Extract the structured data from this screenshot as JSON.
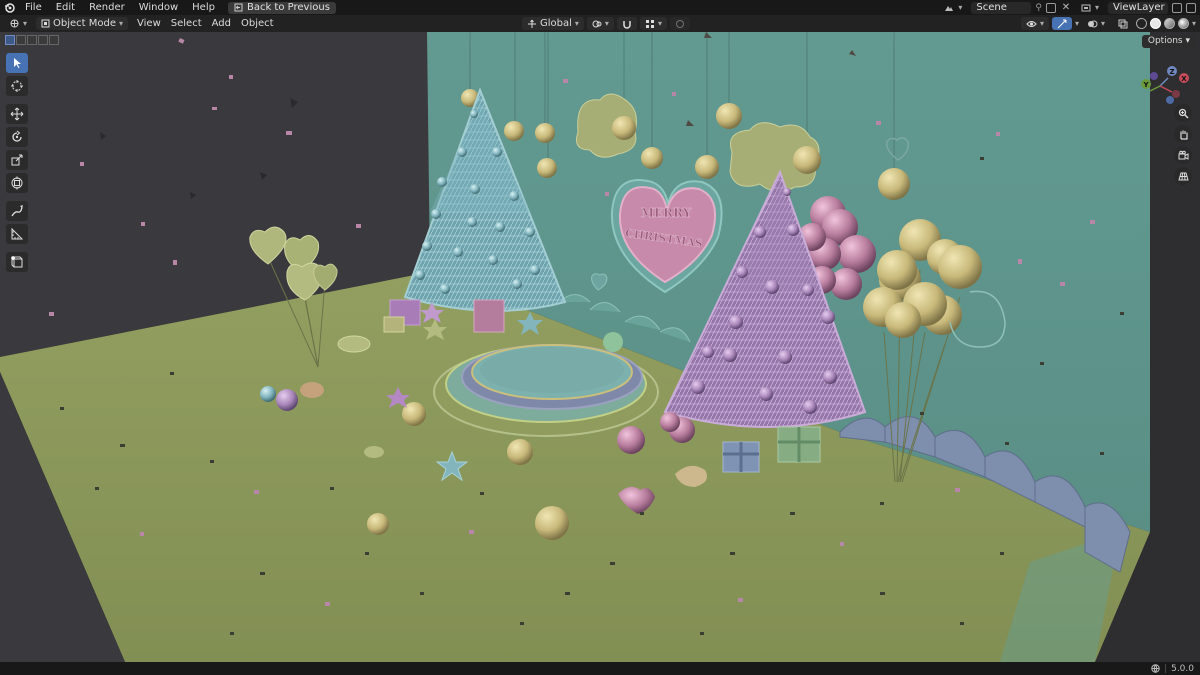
{
  "topbar": {
    "menus": [
      "File",
      "Edit",
      "Render",
      "Window",
      "Help"
    ],
    "back_button": "Back to Previous",
    "scene": "Scene",
    "view_layer": "ViewLayer"
  },
  "header": {
    "mode": "Object Mode",
    "menus": [
      "View",
      "Select",
      "Add",
      "Object"
    ],
    "transform_orientation": "Global"
  },
  "viewport": {
    "options_label": "Options",
    "gizmo": {
      "x": "X",
      "y": "Y",
      "z": "Z"
    },
    "sign_line1": "MERRY",
    "sign_line2": "CHRISTMAS"
  },
  "status": {
    "version": "5.0.0"
  },
  "colors": {
    "wall": "#5e948a",
    "floor": "#8b9a5c",
    "dark_wall": "#3a3a3e",
    "tree_blue": "#7fb3bd",
    "tree_purple": "#a986b9",
    "gold": "#c8b97a",
    "pink": "#b77c9c",
    "accent": "#4772b3"
  }
}
